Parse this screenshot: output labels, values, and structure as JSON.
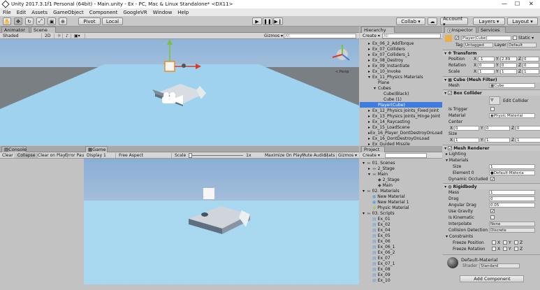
{
  "window_title": "Unity 2017.3.1f1 Personal (64bit) - Main.unity - Ex - PC, Mac & Linux Standalone* <DX11>",
  "menu": [
    "File",
    "Edit",
    "Assets",
    "GameObject",
    "Component",
    "GoogleVR",
    "Window",
    "Help"
  ],
  "toolbar": {
    "pivot": "Pivot",
    "local": "Local",
    "collab": "Collab ▾",
    "account": "Account ▾",
    "layers": "Layers ▾",
    "layout": "Layout ▾"
  },
  "scene": {
    "tab_animator": "Animator",
    "tab_scene": "Scene",
    "shaded": "Shaded",
    "twod": "2D",
    "gizmos": "Gizmos ▾",
    "search": "All",
    "persp": "< Persp"
  },
  "game": {
    "tab_console": "Console",
    "tab_game": "Game",
    "display": "Display 1",
    "aspect": "Free Aspect",
    "scale_label": "Scale",
    "scale_value": "1x",
    "maximize": "Maximize On Play",
    "mute": "Mute Audio",
    "stats": "Stats",
    "gizmos": "Gizmos ▾",
    "clear": "Clear",
    "collapse": "Collapse",
    "clear_on_play": "Clear on Play",
    "error_pause": "Error Pause"
  },
  "hierarchy": {
    "tab": "Hierarchy",
    "create": "Create ▾",
    "search": "All",
    "items": [
      {
        "label": "Ex_06_2_AddTorque",
        "indent": 1,
        "arrow": "▸"
      },
      {
        "label": "Ex_07_Colliders",
        "indent": 1,
        "arrow": "▸"
      },
      {
        "label": "Ex_07_Colliders_1",
        "indent": 1,
        "arrow": "▸"
      },
      {
        "label": "Ex_08_Destroy",
        "indent": 1,
        "arrow": "▸"
      },
      {
        "label": "Ex_09_Instantiate",
        "indent": 1,
        "arrow": "▸"
      },
      {
        "label": "Ex_10_Invoke",
        "indent": 1,
        "arrow": "▸"
      },
      {
        "label": "Ex_11_Physics Materials",
        "indent": 1,
        "arrow": "▾"
      },
      {
        "label": "Plane",
        "indent": 2,
        "arrow": ""
      },
      {
        "label": "Cubes",
        "indent": 2,
        "arrow": "▾"
      },
      {
        "label": "Cube(Black)",
        "indent": 3,
        "arrow": ""
      },
      {
        "label": "Cube (1)",
        "indent": 3,
        "arrow": ""
      },
      {
        "label": "Player(Cube)",
        "indent": 2,
        "arrow": "",
        "selected": true
      },
      {
        "label": "Ex_12_Physics Joints_Fixed Joint",
        "indent": 1,
        "arrow": "▸"
      },
      {
        "label": "Ex_13_Physics Joints_Hinge Joint",
        "indent": 1,
        "arrow": "▸"
      },
      {
        "label": "Ex_14_Raycasting",
        "indent": 1,
        "arrow": "▸"
      },
      {
        "label": "Ex_15_LoadScene",
        "indent": 1,
        "arrow": "▸"
      },
      {
        "label": "Ex_16_Player_DontDestroyOnLoad",
        "indent": 1,
        "arrow": "▸"
      },
      {
        "label": "Ex_16_DontDestroyOnLoad",
        "indent": 1,
        "arrow": "▸"
      },
      {
        "label": "Ex_Guided Missile",
        "indent": 1,
        "arrow": "▸"
      }
    ]
  },
  "project": {
    "tab": "Project",
    "create": "Create ▾",
    "items": [
      {
        "label": "01. Scenes",
        "indent": 0,
        "arrow": "▾",
        "icon": "folder"
      },
      {
        "label": "2_Stage",
        "indent": 1,
        "arrow": "▸",
        "icon": "folder"
      },
      {
        "label": "Main",
        "indent": 1,
        "arrow": "▾",
        "icon": "folder"
      },
      {
        "label": "2_Stage",
        "indent": 2,
        "arrow": "",
        "icon": "scene"
      },
      {
        "label": "Main",
        "indent": 2,
        "arrow": "",
        "icon": "scene"
      },
      {
        "label": "02. Materials",
        "indent": 0,
        "arrow": "▾",
        "icon": "folder"
      },
      {
        "label": "New Material",
        "indent": 1,
        "arrow": "",
        "icon": "material"
      },
      {
        "label": "New Material 1",
        "indent": 1,
        "arrow": "",
        "icon": "material"
      },
      {
        "label": "Physic Material",
        "indent": 1,
        "arrow": "",
        "icon": "physic"
      },
      {
        "label": "03. Scripts",
        "indent": 0,
        "arrow": "▾",
        "icon": "folder"
      },
      {
        "label": "Ex_01",
        "indent": 1,
        "arrow": "",
        "icon": "script"
      },
      {
        "label": "Ex_02",
        "indent": 1,
        "arrow": "",
        "icon": "script"
      },
      {
        "label": "Ex_04",
        "indent": 1,
        "arrow": "",
        "icon": "script"
      },
      {
        "label": "Ex_05",
        "indent": 1,
        "arrow": "",
        "icon": "script"
      },
      {
        "label": "Ex_06",
        "indent": 1,
        "arrow": "",
        "icon": "script"
      },
      {
        "label": "Ex_06_1",
        "indent": 1,
        "arrow": "",
        "icon": "script"
      },
      {
        "label": "Ex_06_2",
        "indent": 1,
        "arrow": "",
        "icon": "script"
      },
      {
        "label": "Ex_07",
        "indent": 1,
        "arrow": "",
        "icon": "script"
      },
      {
        "label": "Ex_07_1",
        "indent": 1,
        "arrow": "",
        "icon": "script"
      },
      {
        "label": "Ex_08",
        "indent": 1,
        "arrow": "",
        "icon": "script"
      },
      {
        "label": "Ex_09",
        "indent": 1,
        "arrow": "",
        "icon": "script"
      },
      {
        "label": "Ex_10",
        "indent": 1,
        "arrow": "",
        "icon": "script"
      }
    ]
  },
  "inspector": {
    "tab": "Inspector",
    "tab2": "Services",
    "object_name": "Player(Cube)",
    "static": "Static ▾",
    "tag_label": "Tag",
    "tag": "Untagged",
    "layer_label": "Layer",
    "layer": "Default",
    "transform": {
      "title": "Transform",
      "position": "Position",
      "rotation": "Rotation",
      "scale": "Scale",
      "pos": [
        "-1",
        "2.89",
        "0"
      ],
      "rot": [
        "0",
        "0",
        "0"
      ],
      "scl": [
        "1",
        "1",
        "1"
      ]
    },
    "meshfilter": {
      "title": "Cube (Mesh Filter)",
      "mesh_label": "Mesh",
      "mesh": "Cube"
    },
    "boxcollider": {
      "title": "Box Collider",
      "edit": "Edit Collider",
      "is_trigger": "Is Trigger",
      "material_label": "Material",
      "material": "Physic Material",
      "center": "Center",
      "center_vals": [
        "0",
        "0",
        "0"
      ],
      "size": "Size",
      "size_vals": [
        "1",
        "1",
        "1"
      ]
    },
    "meshrenderer": {
      "title": "Mesh Renderer",
      "lighting": "Lighting",
      "materials": "Materials",
      "size_label": "Size",
      "size": "1",
      "element0_label": "Element 0",
      "element0": "Default-Materia",
      "dyn_occluded": "Dynamic Occluded"
    },
    "rigidbody": {
      "title": "Rigidbody",
      "mass_label": "Mass",
      "mass": "1",
      "drag_label": "Drag",
      "drag": "0",
      "ang_label": "Angular Drag",
      "ang": "0.05",
      "gravity": "Use Gravity",
      "kinematic": "Is Kinematic",
      "interp_label": "Interpolate",
      "interp": "None",
      "coll_label": "Collision Detection",
      "coll": "Discrete",
      "constraints": "Constraints",
      "freeze_pos": "Freeze Position",
      "freeze_rot": "Freeze Rotation"
    },
    "material": {
      "name": "Default-Material",
      "shader_label": "Shader",
      "shader": "Standard"
    },
    "add_component": "Add Component"
  },
  "xyz": [
    "X",
    "Y",
    "Z"
  ]
}
